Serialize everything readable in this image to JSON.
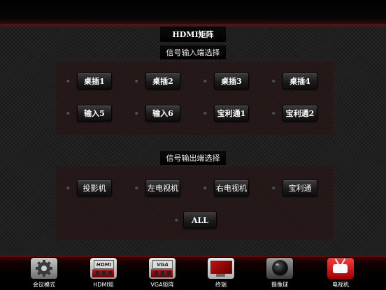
{
  "page": {
    "title": "HDMI矩阵"
  },
  "input_section": {
    "label": "信号输入端选择",
    "buttons": [
      "桌插1",
      "桌插2",
      "桌插3",
      "桌插4",
      "输入5",
      "输入6",
      "宝利通1",
      "宝利通2"
    ]
  },
  "output_section": {
    "label": "信号输出端选择",
    "buttons": [
      "投影机",
      "左电视机",
      "右电视机",
      "宝利通"
    ],
    "all_label": "ALL"
  },
  "nav": {
    "items": [
      {
        "label": "会议模式",
        "icon": "gear-icon"
      },
      {
        "label": "HDMI矩",
        "icon": "hdmi-card-icon",
        "icon_text": "HDMI"
      },
      {
        "label": "VGA矩阵",
        "icon": "vga-card-icon",
        "icon_text": "VGA"
      },
      {
        "label": "终端",
        "icon": "monitor-icon"
      },
      {
        "label": "摄像球",
        "icon": "camera-ball-icon"
      },
      {
        "label": "电视机",
        "icon": "tv-icon"
      }
    ]
  },
  "colors": {
    "accent_red": "#b01818",
    "background": "#202020",
    "button_text": "#ffffff"
  }
}
